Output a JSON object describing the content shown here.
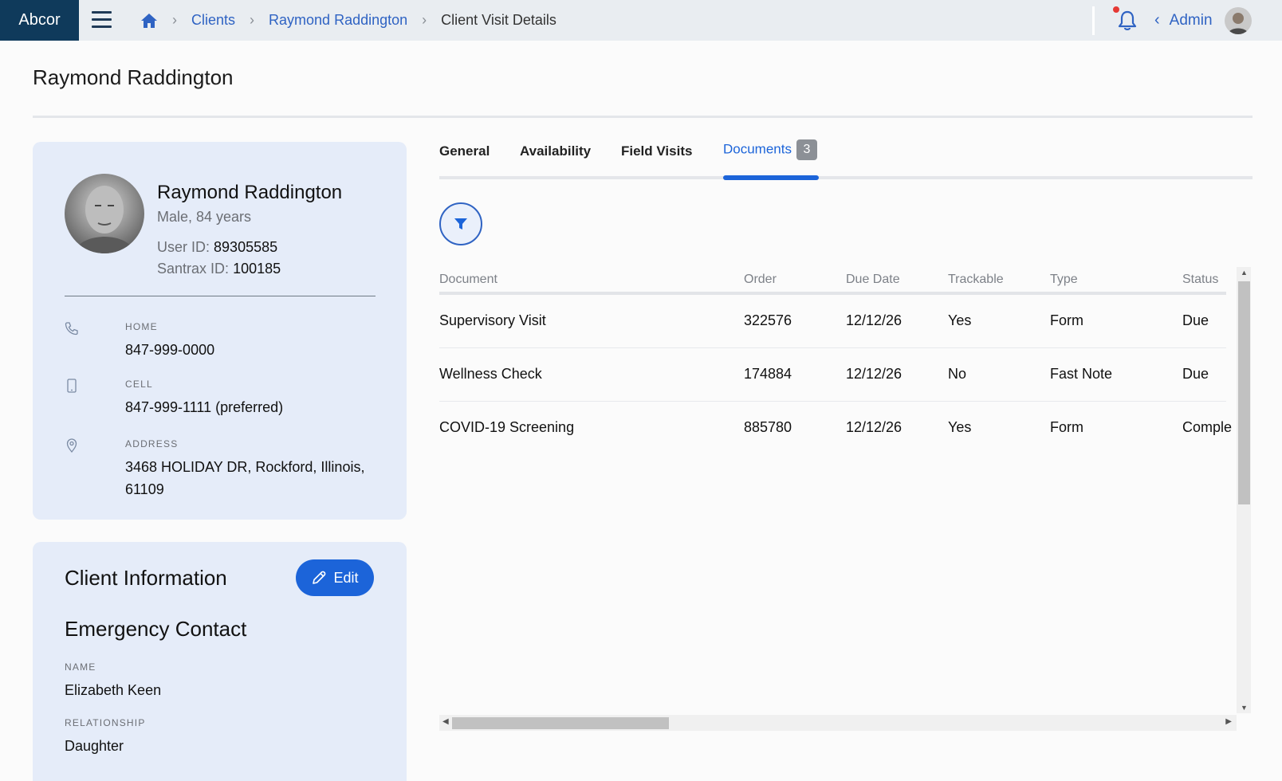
{
  "app": {
    "brand": "Abcor"
  },
  "breadcrumb": {
    "clients": "Clients",
    "client": "Raymond Raddington",
    "current": "Client Visit Details"
  },
  "header": {
    "user": "Admin"
  },
  "page": {
    "title": "Raymond Raddington"
  },
  "client": {
    "name": "Raymond Raddington",
    "meta": "Male, 84 years",
    "user_id_label": "User ID:",
    "user_id": "89305585",
    "santrax_id_label": "Santrax ID:",
    "santrax_id": "100185",
    "home_label": "HOME",
    "home": "847-999-0000",
    "cell_label": "CELL",
    "cell": "847-999-1111 (preferred)",
    "address_label": "ADDRESS",
    "address": "3468 HOLIDAY DR, Rockford, Illinois, 61109"
  },
  "client_info": {
    "title": "Client Information",
    "edit_label": "Edit",
    "emergency_title": "Emergency Contact",
    "name_label": "NAME",
    "name": "Elizabeth Keen",
    "relationship_label": "RELATIONSHIP",
    "relationship": "Daughter"
  },
  "tabs": [
    {
      "label": "General"
    },
    {
      "label": "Availability"
    },
    {
      "label": "Field Visits"
    },
    {
      "label": "Documents",
      "badge": "3"
    }
  ],
  "table": {
    "headers": [
      "Document",
      "Order",
      "Due Date",
      "Trackable",
      "Type",
      "Status"
    ],
    "rows": [
      [
        "Supervisory Visit",
        "322576",
        "12/12/26",
        "Yes",
        "Form",
        "Due"
      ],
      [
        "Wellness Check",
        "174884",
        "12/12/26",
        "No",
        "Fast Note",
        "Due"
      ],
      [
        "COVID-19 Screening",
        "885780",
        "12/12/26",
        "Yes",
        "Form",
        "Comple"
      ]
    ]
  },
  "colors": {
    "primary": "#1c64d9",
    "brand_bg": "#0f3a5b",
    "card_bg": "#e5ecf9",
    "link": "#2f63c3"
  },
  "icons": [
    "menu-icon",
    "home-icon",
    "bell-icon",
    "chevron-left-icon",
    "phone-icon",
    "mobile-icon",
    "location-pin-icon",
    "pencil-icon",
    "filter-icon"
  ]
}
